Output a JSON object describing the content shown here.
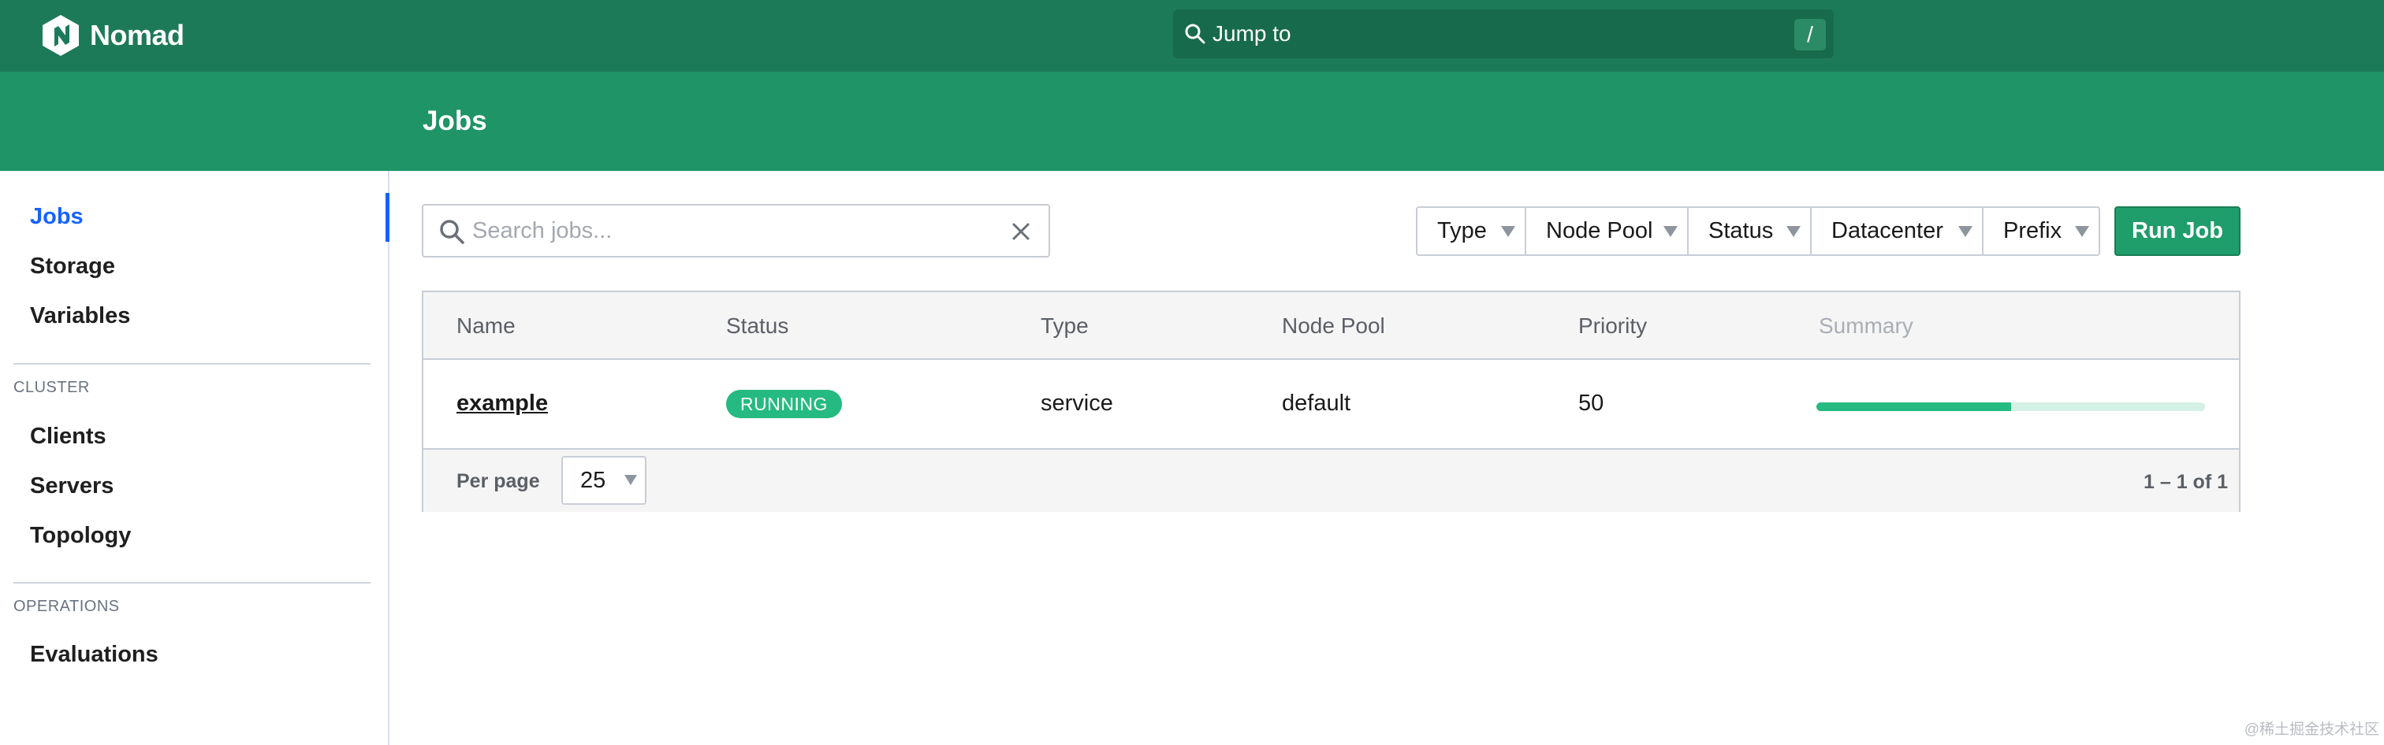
{
  "app": {
    "brand_name": "Nomad",
    "brand_icon": "nomad-logo-icon"
  },
  "topnav": {
    "jump_placeholder": "Jump to",
    "jump_shortcut": "/"
  },
  "page": {
    "title": "Jobs"
  },
  "sidebar": {
    "items": [
      {
        "label": "Jobs",
        "active": true
      },
      {
        "label": "Storage",
        "active": false
      },
      {
        "label": "Variables",
        "active": false
      }
    ],
    "cluster_heading": "CLUSTER",
    "cluster_items": [
      {
        "label": "Clients"
      },
      {
        "label": "Servers"
      },
      {
        "label": "Topology"
      }
    ],
    "operations_heading": "OPERATIONS",
    "operations_items": [
      {
        "label": "Evaluations"
      }
    ]
  },
  "toolbar": {
    "search_placeholder": "Search jobs...",
    "search_icon": "search-icon",
    "clear_icon": "close-icon",
    "filters": [
      "Type",
      "Node Pool",
      "Status",
      "Datacenter",
      "Prefix"
    ],
    "run_job_label": "Run Job"
  },
  "table": {
    "columns": [
      "Name",
      "Status",
      "Type",
      "Node Pool",
      "Priority",
      "Summary"
    ],
    "rows": [
      {
        "name": "example",
        "status": "RUNNING",
        "type": "service",
        "node_pool": "default",
        "priority": "50",
        "summary_fraction": 0.5
      }
    ],
    "footer": {
      "per_page_label": "Per page",
      "per_page_value": "25",
      "range": "1 – 1 of 1"
    }
  },
  "colors": {
    "topnav": "#1d7a59",
    "subnav": "#1e9467",
    "accent": "#1563ff",
    "success": "#25ba81",
    "run_button": "#1f9d6b"
  },
  "watermark": "@稀土掘金技术社区"
}
